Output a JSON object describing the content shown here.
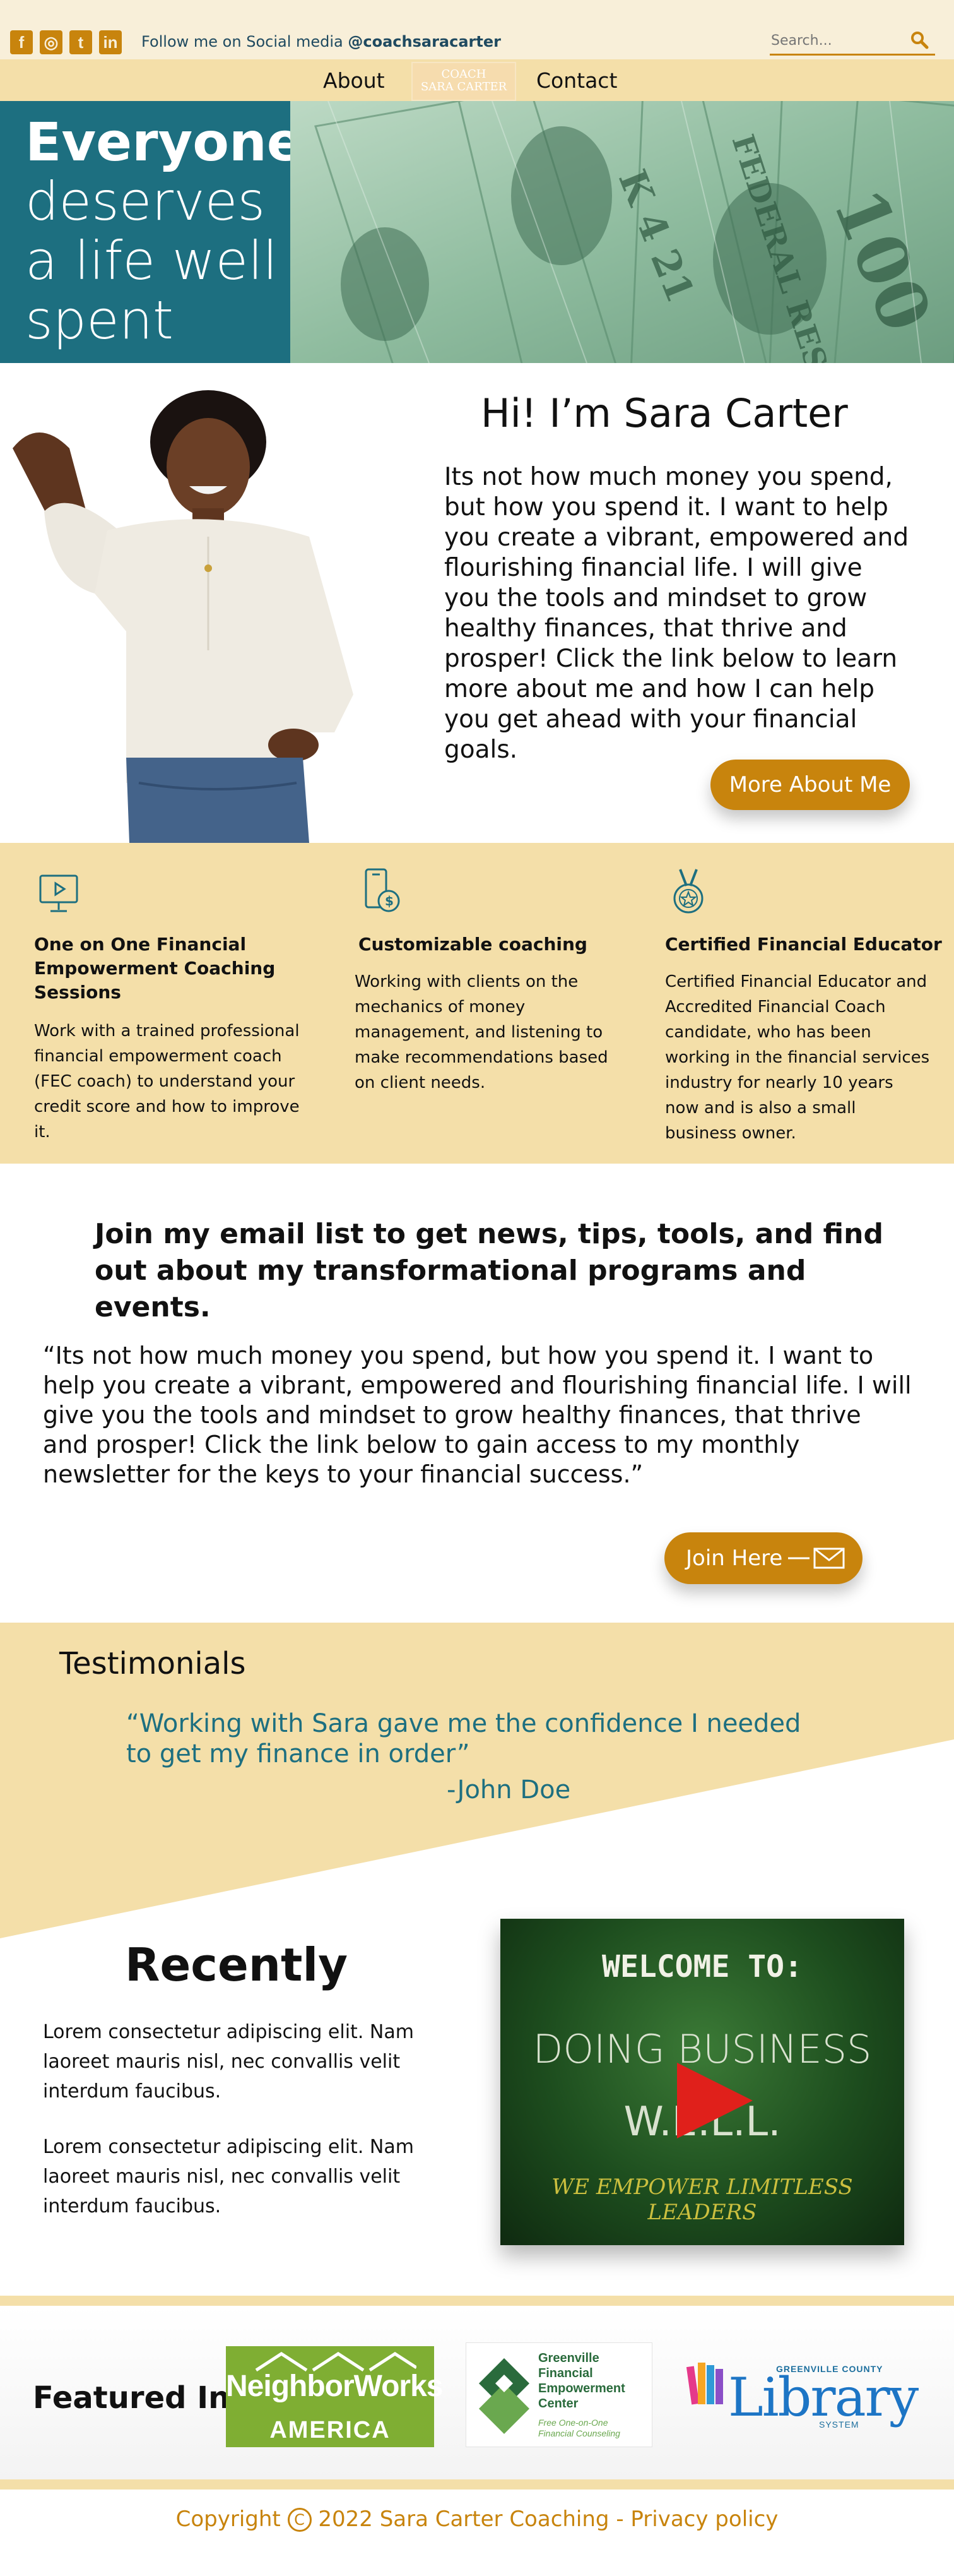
{
  "topbar": {
    "social_icons": [
      "facebook-icon",
      "instagram-icon",
      "twitter-icon",
      "linkedin-icon"
    ],
    "social_glyphs": [
      "f",
      "◎",
      "t",
      "in"
    ],
    "follow_prefix": "Follow me on Social media ",
    "follow_handle": "@coachsaracarter",
    "search_placeholder": "Search..."
  },
  "nav": {
    "about": "About",
    "logo_line1": "COACH",
    "logo_line2": "SARA CARTER",
    "contact": "Contact"
  },
  "hero": {
    "line1": "Everyone",
    "line2": "deserves",
    "line3": "a life well",
    "line4": "spent"
  },
  "intro": {
    "title": "Hi! I’m Sara Carter",
    "body": "Its not how much money you spend, but how you spend it. I want to help you create a vibrant, empowered and flourishing financial life. I will give you the tools and mindset to grow healthy finances, that thrive and prosper! Click the link below to learn more about me and how I can help you get ahead with your financial goals.",
    "button": "More About Me"
  },
  "features": [
    {
      "icon": "monitor-play-icon",
      "title": "One on One Financial Empowerment Coaching Sessions",
      "text": "Work with a trained professional financial empowerment coach (FEC coach) to understand your credit score and how to improve it."
    },
    {
      "icon": "phone-money-icon",
      "title": "Customizable coaching",
      "text": "Working with clients on the mechanics of money management, and listening to make recommendations based on client needs."
    },
    {
      "icon": "medal-icon",
      "title": "Certified Financial Educator",
      "text": "Certified Financial Educator and Accredited Financial Coach candidate, who has been working in the financial services industry for nearly 10 years now and is also a small business owner."
    }
  ],
  "email": {
    "title": "Join my email list to get news, tips, tools, and find out about my transformational programs and events.",
    "quote": "“Its not how much money you spend, but how you spend it. I want to help you create a vibrant, empowered and flourishing financial life. I will give you the tools and mindset to grow healthy finances, that thrive and prosper! Click the link below to gain access to my monthly newsletter for the keys to your financial success.”",
    "button": "Join Here"
  },
  "testimonials": {
    "title": "Testimonials",
    "quote": "“Working with Sara gave me the confidence I needed to get my finance in order”",
    "author": "-John Doe"
  },
  "recently": {
    "title": "Recently",
    "p1": "Lorem consectetur adipiscing elit. Nam laoreet mauris nisl, nec convallis velit interdum faucibus.",
    "p2": "Lorem consectetur adipiscing elit. Nam laoreet mauris nisl, nec convallis velit interdum faucibus.",
    "video": {
      "line1": "WELCOME TO:",
      "line2": "DOING BUSINESS",
      "line3": "W.E.L.L.",
      "line4": "WE EMPOWER LIMITLESS LEADERS"
    }
  },
  "featured": {
    "title": "Featured In",
    "neighborworks_top": "NeighborWorks",
    "neighborworks_bottom": "AMERICA",
    "gfec_name": "Greenville Financial Empowerment Center",
    "gfec_sub": "Free One-on-One Financial Counseling",
    "library_top": "GREENVILLE COUNTY",
    "library_main": "Library",
    "library_bottom": "SYSTEM"
  },
  "footer": {
    "copyright_prefix": "Copyright ",
    "copyright_symbol": "C",
    "copyright_suffix": " 2022 Sara Carter Coaching - Privacy policy"
  },
  "colors": {
    "accent": "#c8840d",
    "teal": "#1d6f80",
    "cream": "#f8efd9",
    "sand": "#f4dfa9",
    "money_green": "#a8cdb5"
  }
}
